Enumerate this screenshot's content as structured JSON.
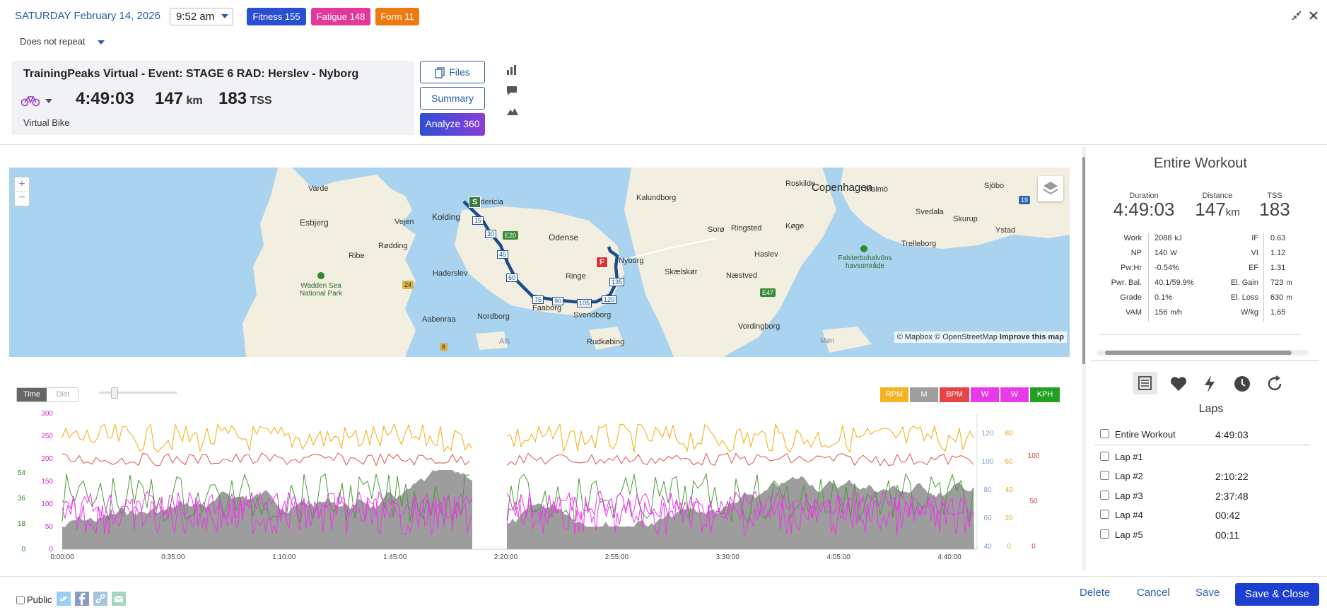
{
  "header": {
    "date": "SATURDAY February 14, 2026",
    "time": "9:52 am",
    "repeat": "Does not repeat",
    "badges": [
      {
        "label": "Fitness 155",
        "color": "#2b4fd1"
      },
      {
        "label": "Fatigue 148",
        "color": "#e23a9b"
      },
      {
        "label": "Form 11",
        "color": "#ee7a0f"
      }
    ]
  },
  "workout": {
    "title": "TrainingPeaks Virtual - Event: STAGE 6 RAD: Herslev - Nyborg",
    "duration": "4:49:03",
    "distance": "147",
    "distance_unit": "km",
    "tss": "183",
    "tss_unit": "TSS",
    "type": "Virtual Bike"
  },
  "buttons": {
    "files": "Files",
    "summary": "Summary",
    "analyze": "Analyze 360"
  },
  "map": {
    "attribution_1": "© Mapbox © OpenStreetMap",
    "attribution_2": "Improve this map",
    "zoom_in": "+",
    "zoom_out": "−",
    "cities_large": [
      "Copenhagen"
    ],
    "labels": [
      {
        "t": "Varde"
      },
      {
        "t": "Esbjerg"
      },
      {
        "t": "Vejen"
      },
      {
        "t": "Kolding"
      },
      {
        "t": "Fredericia"
      },
      {
        "t": "Ribe"
      },
      {
        "t": "Rødding"
      },
      {
        "t": "Haderslev"
      },
      {
        "t": "Aabenraa"
      },
      {
        "t": "Nordborg"
      },
      {
        "t": "Odense"
      },
      {
        "t": "Ringe"
      },
      {
        "t": "Faaborg"
      },
      {
        "t": "Svendborg"
      },
      {
        "t": "Rudkøbing"
      },
      {
        "t": "Nyborg"
      },
      {
        "t": "Kalundborg"
      },
      {
        "t": "Roskilde"
      },
      {
        "t": "Sorø"
      },
      {
        "t": "Ringsted"
      },
      {
        "t": "Køge"
      },
      {
        "t": "Haslev"
      },
      {
        "t": "Skælskør"
      },
      {
        "t": "Næstved"
      },
      {
        "t": "Vordingborg"
      },
      {
        "t": "Malmö"
      },
      {
        "t": "Sjöbo"
      },
      {
        "t": "Svedala"
      },
      {
        "t": "Skurup"
      },
      {
        "t": "Ystad"
      },
      {
        "t": "Trelleborg"
      },
      {
        "t": "Als"
      },
      {
        "t": "Møn"
      },
      {
        "t": "Wadden Sea National Park"
      },
      {
        "t": "Falsterbohalvöns havsområde"
      }
    ],
    "road_shields": [
      "E20",
      "24",
      "8",
      "E47",
      "19"
    ],
    "route_markers": [
      "15",
      "30",
      "45",
      "60",
      "75",
      "90",
      "105",
      "120",
      "135"
    ],
    "start_label": "S",
    "finish_label": "F"
  },
  "chart_controls": {
    "time": "Time",
    "dist": "Dist",
    "series": [
      {
        "label": "RPM",
        "color": "#f5b221"
      },
      {
        "label": "M",
        "color": "#9e9e9e"
      },
      {
        "label": "BPM",
        "color": "#e64545"
      },
      {
        "label": "W",
        "color": "#e83ae8"
      },
      {
        "label": "W",
        "color": "#e83ae8"
      },
      {
        "label": "KPH",
        "color": "#22a022"
      }
    ]
  },
  "chart_data": {
    "type": "line",
    "x_ticks": [
      "0:00:00",
      "0:35:00",
      "1:10:00",
      "1:45:00",
      "2:20:00",
      "2:55:00",
      "3:30:00",
      "4:05:00",
      "4:40:00"
    ],
    "y_left_power": [
      0,
      50,
      100,
      150,
      200,
      250,
      300
    ],
    "y_left_speed": [
      0,
      18,
      36,
      54
    ],
    "y_right_elev": [
      40,
      60,
      80,
      100,
      120
    ],
    "y_right_cadence": [
      0,
      20,
      40,
      60,
      80
    ],
    "y_right_hr": [
      0,
      50,
      100
    ]
  },
  "right": {
    "title": "Entire Workout",
    "duration_label": "Duration",
    "distance_label": "Distance",
    "tss_label": "TSS",
    "duration": "4:49:03",
    "distance": "147",
    "distance_unit": "km",
    "tss": "183",
    "stats_left": [
      {
        "k": "Work",
        "v": "2088",
        "u": "kJ"
      },
      {
        "k": "NP",
        "v": "140",
        "u": "W"
      },
      {
        "k": "Pw:Hr",
        "v": "-0.54%",
        "u": ""
      },
      {
        "k": "Pwr. Bal.",
        "v": "40.1/59.9%",
        "u": ""
      },
      {
        "k": "Grade",
        "v": "0.1%",
        "u": ""
      },
      {
        "k": "VAM",
        "v": "156",
        "u": "m/h"
      }
    ],
    "stats_right": [
      {
        "k": "IF",
        "v": "0.63",
        "u": ""
      },
      {
        "k": "VI",
        "v": "1.12",
        "u": ""
      },
      {
        "k": "EF",
        "v": "1.31",
        "u": ""
      },
      {
        "k": "El. Gain",
        "v": "723",
        "u": "m"
      },
      {
        "k": "El. Loss",
        "v": "630",
        "u": "m"
      },
      {
        "k": "W/kg",
        "v": "1.65",
        "u": ""
      }
    ],
    "laps_title": "Laps",
    "laps": [
      {
        "name": "Entire Workout",
        "time": "4:49:03"
      },
      {
        "name": "Lap #1",
        "time": ""
      },
      {
        "name": "Lap #2",
        "time": "2:10:22"
      },
      {
        "name": "Lap #3",
        "time": "2:37:48"
      },
      {
        "name": "Lap #4",
        "time": "00:42"
      },
      {
        "name": "Lap #5",
        "time": "00:11"
      }
    ]
  },
  "footer": {
    "public": "Public",
    "delete": "Delete",
    "cancel": "Cancel",
    "save": "Save",
    "save_close": "Save & Close"
  }
}
